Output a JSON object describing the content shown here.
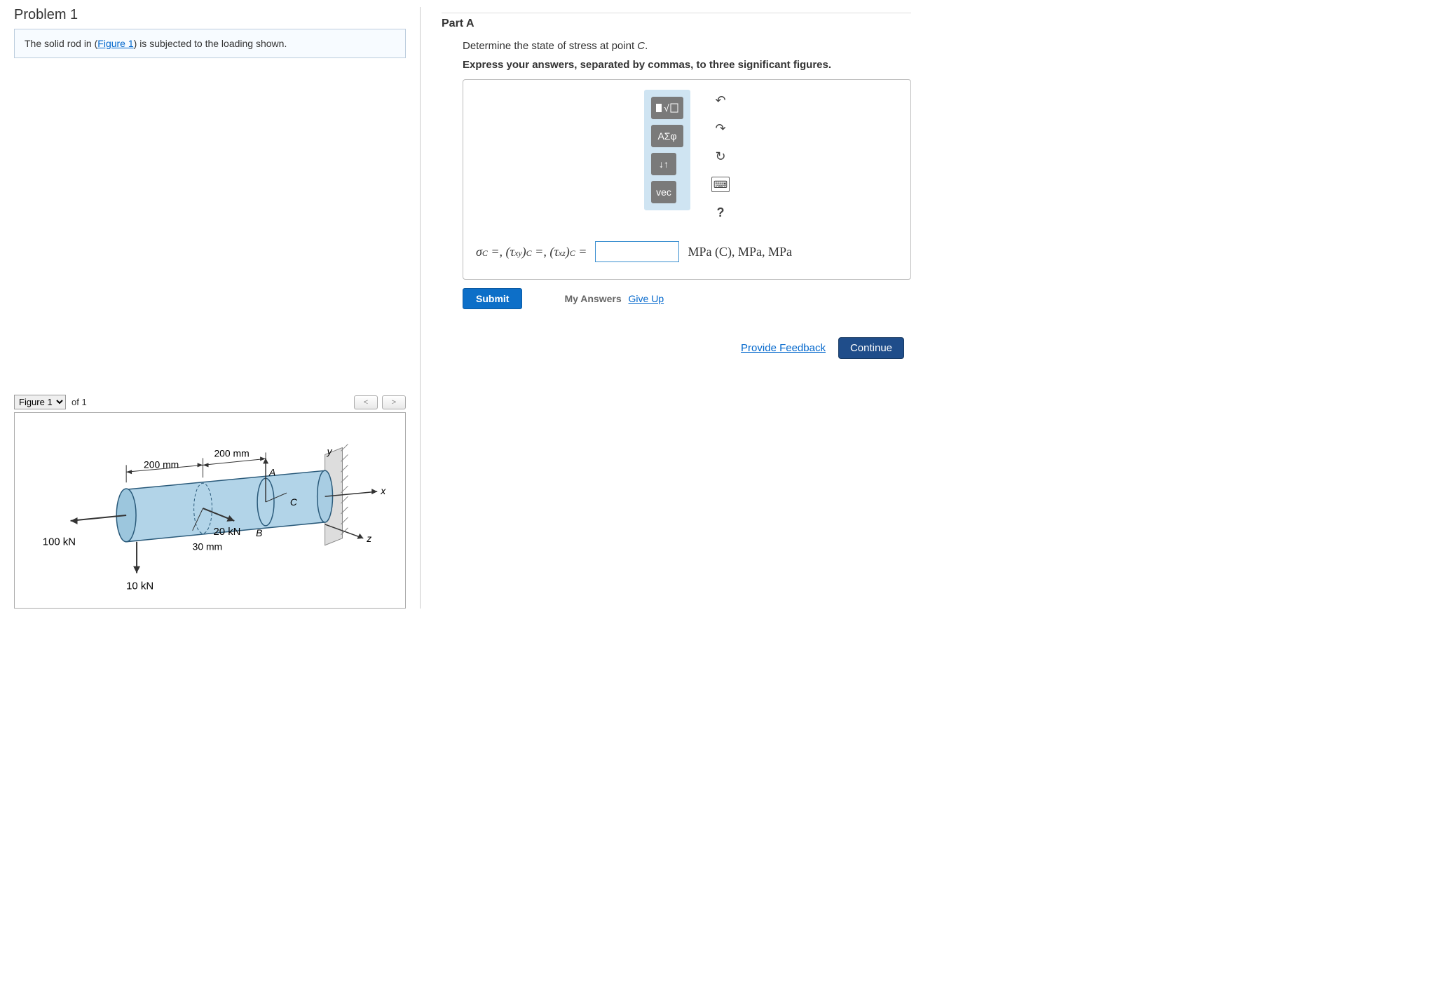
{
  "left": {
    "problem_title": "Problem 1",
    "prompt_pre": "The solid rod in (",
    "figure_link": "Figure 1",
    "prompt_post": ") is subjected to the loading shown."
  },
  "figure": {
    "select": "Figure 1",
    "of_label": "of 1",
    "nav_prev": "<",
    "nav_next": ">",
    "dim1": "200 mm",
    "dim2": "200 mm",
    "radius": "30 mm",
    "force_left": "100 kN",
    "force_down": "10 kN",
    "force_mid": "20 kN",
    "axis_x": "x",
    "axis_y": "y",
    "axis_z": "z",
    "ptA": "A",
    "ptB": "B",
    "ptC": "C"
  },
  "partA": {
    "header": "Part A",
    "instr1_pre": "Determine the state of stress at point ",
    "instr1_point": "C",
    "instr1_post": ".",
    "instr2": "Express your answers, separated by commas, to three significant figures.",
    "tools": {
      "sqrt": "√",
      "greek": "ΑΣφ",
      "updown": "↓↑",
      "vec": "vec",
      "undo": "↶",
      "redo": "↷",
      "reset": "↻",
      "keyboard": "⌨",
      "help": "?"
    },
    "formula": "σ_C =, (τ_xy)_C =, (τ_xz)_C =",
    "units": "MPa (C), MPa, MPa",
    "submit": "Submit",
    "my_answers": "My Answers",
    "give_up": "Give Up"
  },
  "footer": {
    "feedback": "Provide Feedback",
    "continue": "Continue"
  }
}
